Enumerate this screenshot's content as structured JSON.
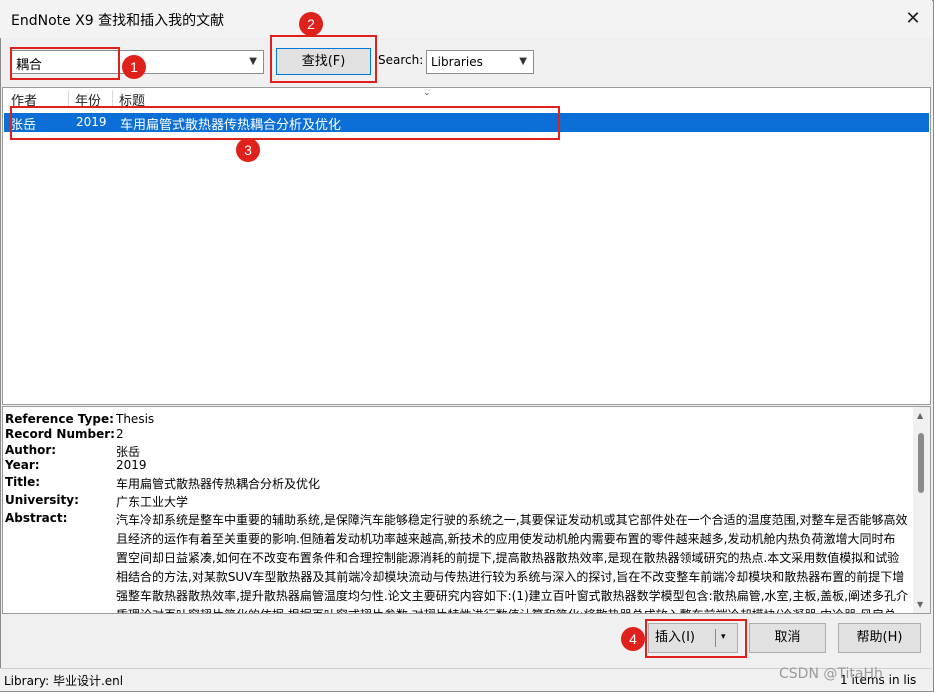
{
  "window": {
    "title": "EndNote X9 查找和插入我的文献",
    "close_glyph": "✕"
  },
  "search": {
    "value": "耦合",
    "find_label": "查找(F)",
    "scope_label": "Search:",
    "scope_value": "Libraries"
  },
  "results": {
    "columns": [
      "作者",
      "年份",
      "标题"
    ],
    "rows": [
      {
        "author": "张岳",
        "year": "2019",
        "title": "车用扁管式散热器传热耦合分析及优化"
      }
    ]
  },
  "preview": {
    "fields": [
      {
        "label": "Reference Type:",
        "value": "Thesis"
      },
      {
        "label": "Record Number:",
        "value": "2"
      },
      {
        "label": "Author:",
        "value": "张岳"
      },
      {
        "label": "Year:",
        "value": "2019"
      },
      {
        "label": "Title:",
        "value": "车用扁管式散热器传热耦合分析及优化"
      },
      {
        "label": "University:",
        "value": "广东工业大学"
      }
    ],
    "abstract_label": "Abstract:",
    "abstract_lines": [
      "汽车冷却系统是整车中重要的辅助系统,是保障汽车能够稳定行驶的系统之一,其要保证发动机或其它部件处在一个合适的温度范围,对整车是否能够高效",
      "且经济的运作有着至关重要的影响.但随着发动机功率越来越高,新技术的应用使发动机舱内需要布置的零件越来越多,发动机舱内热负荷激增大同时布",
      "置空间却日益紧凑,如何在不改变布置条件和合理控制能源消耗的前提下,提高散热器散热效率,是现在散热器领域研究的热点.本文采用数值模拟和试验",
      "相结合的方法,对某款SUV车型散热器及其前端冷却模块流动与传热进行较为系统与深入的探讨,旨在不改变整车前端冷却模块和散热器布置的前提下增",
      "强整车散热器散热效率,提升散热器扁管温度均匀性.论文主要研究内容如下:(1)建立百叶窗式散热器数学模型包含:散热扁管,水室,主板,盖板,阐述多孔介",
      "质理论对百叶窗翅片简化的依据,根据百叶窗式翅片参数,对翅片特性进行数值计算和简化;将散热器总成放入整车前端冷却模块(冷凝器,中冷器,风扇总"
    ]
  },
  "buttons": {
    "insert": "插入(I)",
    "insert_dropdown": "▾",
    "cancel": "取消",
    "help": "帮助(H)"
  },
  "status": {
    "library": "Library: 毕业设计.enl",
    "items": "1 items in lis"
  },
  "watermark": "CSDN @TitaHh",
  "annotations": [
    "1",
    "2",
    "3",
    "4"
  ],
  "colors": {
    "selection": "#0c6fd8",
    "annotation": "#e0201a",
    "focus": "#0078d7"
  }
}
